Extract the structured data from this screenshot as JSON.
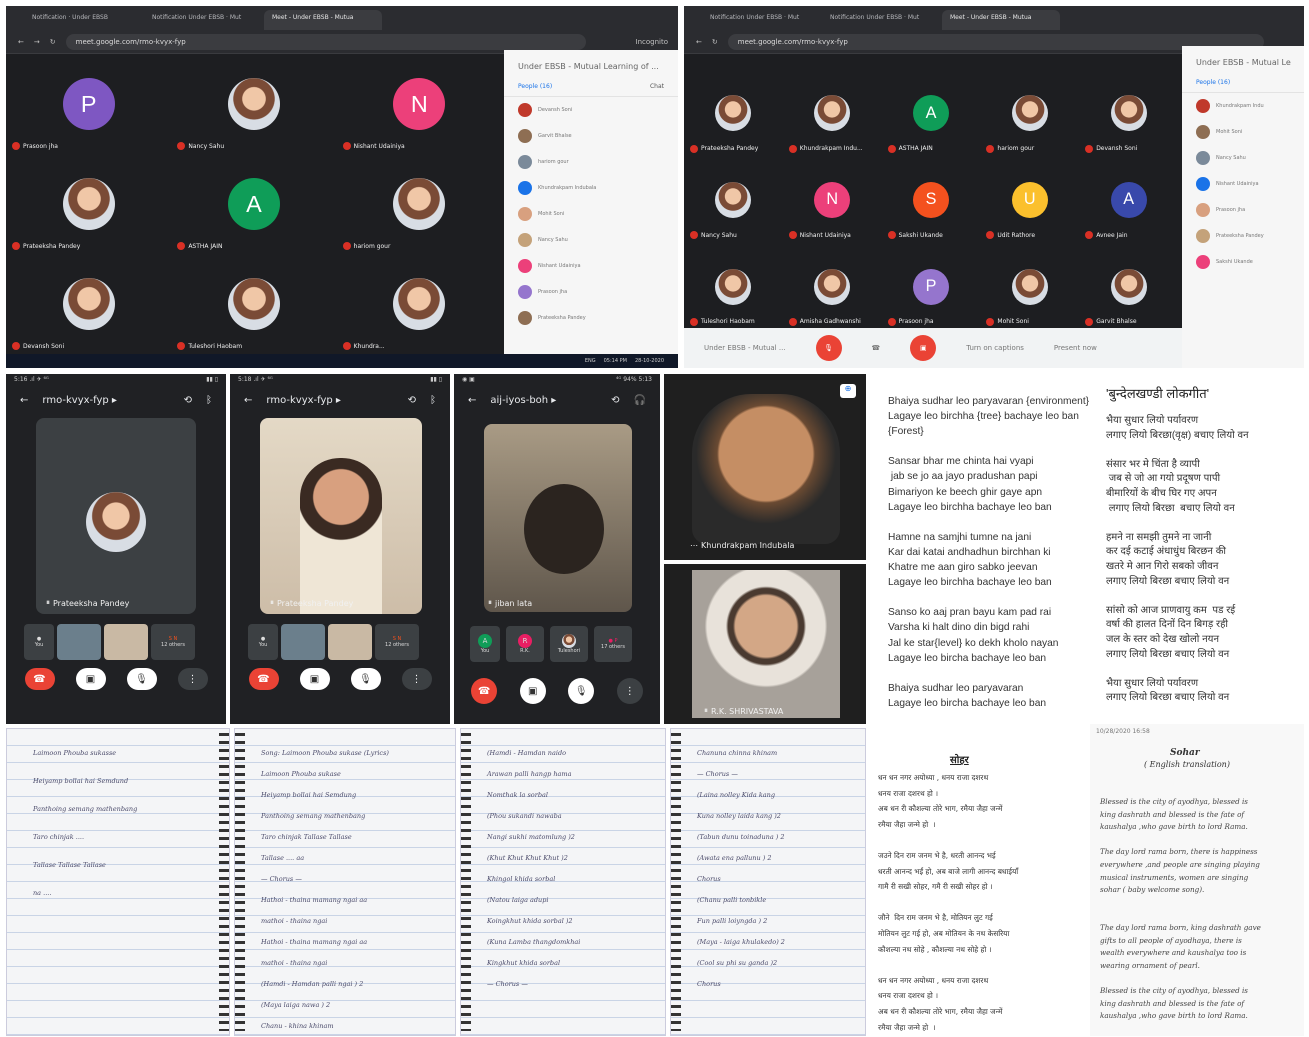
{
  "meet1": {
    "tabs": [
      "Notification · Under EBSB",
      "Notification Under EBSB · Mut",
      "Meet - Under EBSB - Mutua"
    ],
    "url": "meet.google.com/rmo-kvyx-fyp",
    "profile": "Incognito",
    "participants": [
      {
        "name": "Prasoon jha",
        "letter": "P",
        "color": "#7e57c2"
      },
      {
        "name": "Nancy Sahu",
        "letter": "",
        "color": ""
      },
      {
        "name": "Nishant Udainiya",
        "letter": "N",
        "color": "#ec407a"
      },
      {
        "name": "Prateeksha Pandey",
        "letter": "",
        "color": ""
      },
      {
        "name": "ASTHA JAIN",
        "letter": "A",
        "color": "#0f9d58"
      },
      {
        "name": "hariom gour",
        "letter": "",
        "color": ""
      },
      {
        "name": "Devansh Soni",
        "letter": "",
        "color": ""
      },
      {
        "name": "Tuleshori Haobam",
        "letter": "",
        "color": ""
      },
      {
        "name": "Khundra...",
        "letter": "",
        "color": ""
      }
    ],
    "side_title": "Under EBSB - Mutual Learning of ...",
    "people_tab": "People (16)",
    "chat_tab": "Chat",
    "people": [
      "Devansh Soni",
      "Garvit Bhalse",
      "hariom gour",
      "Khundrakpam Indubala",
      "Mohit Soni",
      "Nancy Sahu",
      "Nishant Udainiya",
      "Prasoon jha",
      "Prateeksha Pandey"
    ],
    "taskbar_time": "05:14 PM",
    "taskbar_date": "28-10-2020",
    "taskbar_lang": "ENG"
  },
  "meet2": {
    "tabs": [
      "Notification Under EBSB · Mut",
      "Notification Under EBSB · Mut",
      "Meet - Under EBSB - Mutua"
    ],
    "url": "meet.google.com/rmo-kvyx-fyp",
    "participants": [
      {
        "name": "Prateeksha Pandey",
        "letter": "",
        "color": ""
      },
      {
        "name": "Khundrakpam Indu...",
        "letter": "",
        "color": ""
      },
      {
        "name": "ASTHA JAIN",
        "letter": "A",
        "color": "#0f9d58"
      },
      {
        "name": "hariom gour",
        "letter": "",
        "color": ""
      },
      {
        "name": "Devansh Soni",
        "letter": "",
        "color": ""
      },
      {
        "name": "Nancy Sahu",
        "letter": "",
        "color": ""
      },
      {
        "name": "Nishant Udainiya",
        "letter": "N",
        "color": "#ec407a"
      },
      {
        "name": "Sakshi Ukande",
        "letter": "S",
        "color": "#f4511e"
      },
      {
        "name": "Udit Rathore",
        "letter": "U",
        "color": "#fbc02d"
      },
      {
        "name": "Avnee Jain",
        "letter": "A",
        "color": "#3949ab"
      },
      {
        "name": "Tuleshori Haobam",
        "letter": "",
        "color": ""
      },
      {
        "name": "Amisha Gadhwanshi",
        "letter": "",
        "color": ""
      },
      {
        "name": "Prasoon jha",
        "letter": "P",
        "color": "#9575cd"
      },
      {
        "name": "Mohit Soni",
        "letter": "",
        "color": ""
      },
      {
        "name": "Garvit Bhalse",
        "letter": "",
        "color": ""
      }
    ],
    "side_title": "Under EBSB - Mutual Le",
    "people_tab": "People (16)",
    "people": [
      "Khundrakpam Indu",
      "Mohit Soni",
      "Nancy Sahu",
      "Nishant Udainiya",
      "Prasoon jha",
      "Prateeksha Pandey",
      "Sakshi Ukande"
    ],
    "meeting_label": "Under EBSB - Mutual ...",
    "captions": "Turn on captions",
    "present": "Present now"
  },
  "phone1": {
    "status_left": "5:16 .ıl ✈ ⁶ᴳ",
    "status_right": "▮▮ ▯",
    "code": "rmo-kvyx-fyp ▸",
    "name": "Prateeksha Pandey",
    "you": "You",
    "others": "12 others"
  },
  "phone2": {
    "status_left": "5:18 .ıl ✈ ⁶ᴳ",
    "status_right": "▮▮ ▯",
    "code": "rmo-kvyx-fyp ▸",
    "name": "Prateeksha Pandey",
    "you": "You",
    "others": "12 others"
  },
  "phone3": {
    "status_left": "◉ ▣",
    "status_right": "⁴ᴳ 94% 5:13",
    "code": "aij-iyos-boh ▸",
    "name": "jiban lata",
    "you": "You",
    "t2": "R.K.",
    "t3": "Tuleshori",
    "others": "17 others"
  },
  "video1": {
    "name": "Khundrakpam Indubala"
  },
  "video2": {
    "name": "R.K. SHRIVASTAVA"
  },
  "lyrics_en": "Bhaiya sudhar leo paryavaran {environment}\nLagaye leo birchha {tree} bachaye leo ban\n{Forest}\n\nSansar bhar me chinta hai vyapi\n jab se jo aa jayo pradushan papi\nBimariyon ke beech ghir gaye apn\nLagaye leo birchha bachaye leo ban\n\nHamne na samjhi tumne na jani\nKar dai katai andhadhun birchhan ki\nKhatre me aan giro sabko jeevan\nLagaye leo birchha bachaye leo ban\n\nSanso ko aaj pran bayu kam pad rai\nVarsha ki halt dino din bigd rahi\nJal ke star{level} ko dekh kholo nayan\nLagaye leo bircha bachaye leo ban\n\nBhaiya sudhar leo paryavaran\nLagaye leo bircha bachaye leo ban",
  "lyrics_hi_title": "'बुन्देलखण्डी लोकगीत'",
  "lyrics_hi": "भैया सुधार लियो पर्यावरण\nलगाए लियो बिरछा(वृक्ष) बचाए लियो वन\n\nसंसार भर मे चिंता है व्यापी\n जब से जो आ गयो प्रदूषण पापी\nबीमारियों के बीच घिर गए अपन\n लगाए लियो बिरछा  बचाए लियो वन\n\nहमने ना समझी तुमने ना जानी\nकर दई कटाई अंधाधुंध बिरछन की\nखतरे मे आन गिरो सबको जीवन\nलगाए लियो बिरछा बचाए लियो वन\n\nसांसो को आज प्राणवायु कम  पड रई\nवर्षा की हालत दिनों दिन बिगड़ रही\nजल के स्तर को देख खोलो नयन\nलगाए लियो बिरछा बचाए लियो वन\n\nभैया सुधार लियो पर्यावरण\nलगाए लियो बिरछा बचाए लियो वन",
  "notes": [
    [
      "Laimoon  Phouba  sukasse",
      "Heiyamp  bollai  hai   Semdund",
      "Panthoing  semang  mathenbang",
      "Taro  chinjak ....",
      "Tallase     Tallase     Tallase",
      "na ...."
    ],
    [
      "Song: Laimoon Phouba sukase (Lyrics)",
      "Laimoon  Phouba  sukase",
      "Heiyamp  bollai  hai   Semdung",
      "Panthoing  semang  mathenbang",
      "Taro  chinjak  Tallase  Tallase",
      "Tallase  .... aa",
      "— Chorus —",
      "Hathoi - thaina  mamang  ngai  aa",
      "mathoi - thaina  ngai",
      "Hathoi - thaina  mamang  ngai  aa",
      "mathoi - thaina  ngai",
      "(Hamdi - Hamdan  palli  ngai ) 2",
      "(Maya  laiga  nawa ) 2",
      "Chanu - khina  khinam"
    ],
    [
      "(Hamdi - Hamdan  naido",
      "Arawan  palli  hangp  hama",
      "Nomthak  la   sorbal",
      "(Phou  sukandi  nawaba",
      "Nangi  sukhi  matomlung )2",
      "(Khut  Khut  Khut  Khut  )2",
      "Khingol  khida  sorbal",
      "(Natou  laiga  adupi",
      "Koingkhut  khida  sorbal )2",
      "(Kuna  Lamba  thangdomkhai",
      "Kingkhut  khida  sorbal",
      "— Chorus —"
    ],
    [
      "Chanuna  chinna  khinam",
      "— Chorus —",
      "(Laina  nolley  Kida  kang",
      "Kuna  nolley  laida  kang )2",
      "(Tabun  dunu  toinaduna ) 2",
      "(Awata  ena  pallunu ) 2",
      "Chorus",
      "(Chanu  palli  tonbikle",
      "Fun  palli  loiyngda  ) 2",
      "(Maya - laiga  khulakedo) 2",
      "(Cool  su   phi  su  ganda )2",
      "Chorus"
    ]
  ],
  "sohar_date": "10/28/2020 16:58",
  "sohar_hi_title": "सोहर",
  "sohar_hi": "धन धन नगर अयोध्या , धनय राजा दशरथ\nधनय राजा दशरथ हो ।\nअब धन री कौशल्या तोरे भाग, रमैया जैहा जन्में\nरमैया जैहा जन्मे हो  ।\n\nजउने दिन राम जनम भे है, धरती आनन्द भई\nधरती आनन्द भईं हो, अब बाजे लागी आनन्द बधाईयाँ\nगामै री सखी सोहर, गमै री सखी सोहर हो ।\n\nजौने  दिन राम जनम भे है, मोतियन लुट गई\nमोतियन लुट गई हो, अब मोतियन के नथ केसरिया\nकौशल्या नथ सोहे , कौशल्या नथ सोहे हो ।\n\nधन धन नगर अयोध्या , धनय राजा दशरथ\nधनय राजा दशरथ हो ।\nअब धन री कौशल्या तोरे भाग, रमैया जैहा जन्में\nरमैया जैहा जन्मे हो  ।",
  "sohar_en_title": "Sohar",
  "sohar_en_sub": "( English translation)",
  "sohar_en": "Blessed is the city of ayodhya, blessed is\nking dashrath and blessed is the fate of\nkaushalya ,who gave birth to lord Rama.\n\nThe day lord rama born, there is happiness\neverywhere ,and people are singing playing\nmusical instruments, women are singing\nsohar ( baby welcome song).\n\n\nThe day lord rama born, king dashrath gave\ngifts to all people of ayodhaya, there is\nwealth everywhere and kaushalya too is\nwearing ornament of pearl.\n\nBlessed is the city of ayodhya, blessed is\nking dashrath and blessed is the fate of\nkaushalya ,who gave birth to lord Rama."
}
